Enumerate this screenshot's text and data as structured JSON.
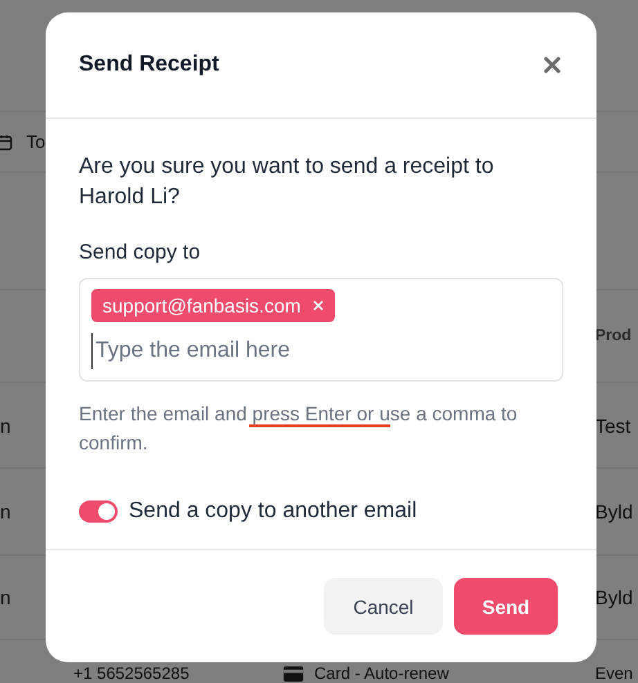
{
  "background": {
    "toolbar": {
      "date_label": "To"
    },
    "table": {
      "columns": [
        {},
        {},
        {},
        {
          "label": "Prod"
        }
      ],
      "rows": [
        {
          "column_1": "n",
          "column_4": "Test"
        },
        {
          "column_1": "n",
          "column_4": "Byld"
        },
        {
          "column_1": "n",
          "column_4": "Byld"
        },
        {
          "column_2": "+1 5652565285",
          "column_3": "Card - Auto-renew",
          "column_4": "Even"
        }
      ]
    }
  },
  "dialog": {
    "title": "Send Receipt",
    "message": "Are you sure you want to send a receipt to Harold Li?",
    "field_label": "Send copy to",
    "tags": [
      {
        "text": "support@fanbasis.com"
      }
    ],
    "input": {
      "placeholder": "Type the email here"
    },
    "hint": "Enter the email and press Enter or use a comma to confirm.",
    "hint_underlined": true,
    "toggle": {
      "on": true,
      "label": "Send a copy to another email"
    },
    "buttons": [
      {
        "label": "Cancel",
        "kind": "secondary"
      },
      {
        "label": "Send",
        "kind": "primary"
      }
    ]
  }
}
